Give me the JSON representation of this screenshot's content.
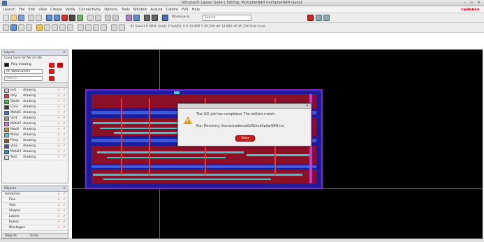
{
  "window": {
    "title": "Virtuoso® Layout Suite L Editing: MultiplierN4H multiplierN4H layout",
    "controls": "– ▫ ✕"
  },
  "menubar": {
    "items": [
      "Launch",
      "File",
      "Edit",
      "View",
      "Create",
      "Verify",
      "Connectivity",
      "Options",
      "Tools",
      "Window",
      "Assura",
      "Calibre",
      "PVS",
      "Help"
    ],
    "brand": "cadence"
  },
  "toolbar": {
    "workspace_label": "Workspace:",
    "search_placeholder": "Search",
    "coords": "(F) Select:0  DRD:  Sel(I): 0  Sel(O): 0  X 12.895  Y 45.220  dX 12.895  dY 45.220  Dist  Cmd:"
  },
  "layers_panel": {
    "title": "Layers",
    "filter": "Used  Valid  AV  NV  AS  NS",
    "current_layer": "Poly drawing",
    "show_all": "All Valid Layers",
    "search_placeholder": "Search",
    "rows": [
      {
        "name": "Inst",
        "purpose": "drawing",
        "color": "#cfcfcf"
      },
      {
        "name": "Poly",
        "purpose": "drawing",
        "color": "#e23b3b"
      },
      {
        "name": "Oxide",
        "purpose": "drawing",
        "color": "#3fbf3f"
      },
      {
        "name": "Cont",
        "purpose": "drawing",
        "color": "#3a3a3a"
      },
      {
        "name": "Metal1",
        "purpose": "drawing",
        "color": "#3d6fd8"
      },
      {
        "name": "Via1",
        "purpose": "drawing",
        "color": "#9a9a9a"
      },
      {
        "name": "Metal2",
        "purpose": "drawing",
        "color": "#d07acb"
      },
      {
        "name": "Nwell",
        "purpose": "drawing",
        "color": "#c59a2b"
      },
      {
        "name": "Nimp",
        "purpose": "drawing",
        "color": "#56d0d0"
      },
      {
        "name": "Pimp",
        "purpose": "drawing",
        "color": "#8a5a2b"
      },
      {
        "name": "Via2",
        "purpose": "drawing",
        "color": "#5050a0"
      },
      {
        "name": "Metal3",
        "purpose": "drawing",
        "color": "#2a8ad0"
      },
      {
        "name": "Text",
        "purpose": "drawing",
        "color": "#e0e0e0"
      }
    ]
  },
  "objects_panel": {
    "title": "Objects",
    "rows": [
      "Instances",
      "Pins",
      "Vias",
      "Shapes",
      "Labels",
      "Rulers",
      "Blockages"
    ],
    "tabs": [
      "Objects",
      "Grids"
    ]
  },
  "dialog": {
    "message1": "The LVS job has completed. The netlists match.",
    "message2": "Run Directory: /home/cadence/LVS/multiplierN4H.lvs",
    "button": "Close"
  }
}
